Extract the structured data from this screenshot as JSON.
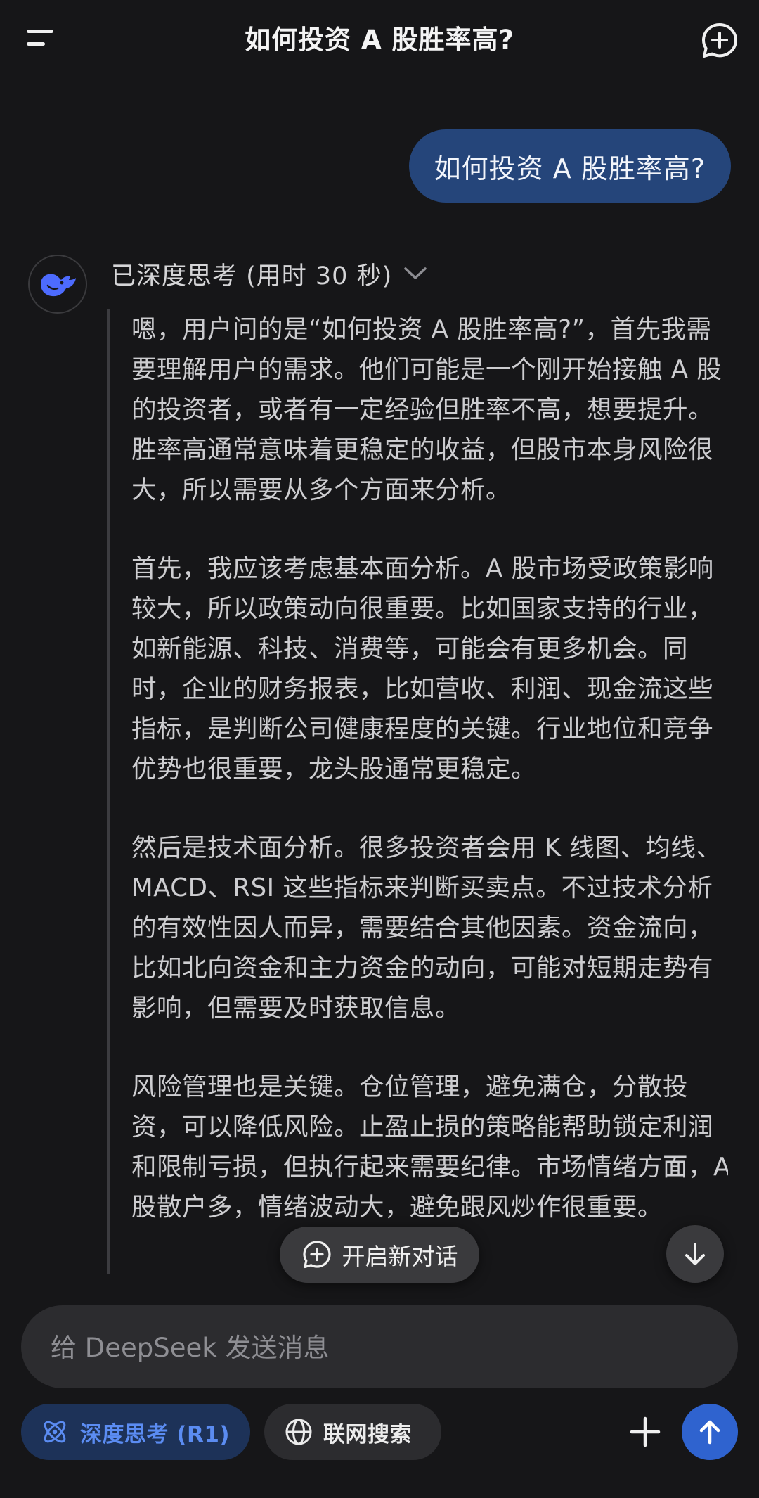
{
  "header": {
    "title": "如何投资 A 股胜率高?"
  },
  "chat": {
    "user_message": "如何投资 A 股胜率高?",
    "assistant": {
      "thinking_label": "已深度思考 (用时 30 秒)",
      "reasoning": [
        "嗯，用户问的是“如何投资 A 股胜率高?”，首先我需要理解用户的需求。他们可能是一个刚开始接触 A 股的投资者，或者有一定经验但胜率不高，想要提升。胜率高通常意味着更稳定的收益，但股市本身风险很大，所以需要从多个方面来分析。",
        "首先，我应该考虑基本面分析。A 股市场受政策影响较大，所以政策动向很重要。比如国家支持的行业，如新能源、科技、消费等，可能会有更多机会。同时，企业的财务报表，比如营收、利润、现金流这些指标，是判断公司健康程度的关键。行业地位和竞争优势也很重要，龙头股通常更稳定。",
        "然后是技术面分析。很多投资者会用 K 线图、均线、MACD、RSI 这些指标来判断买卖点。不过技术分析的有效性因人而异，需要结合其他因素。资金流向，比如北向资金和主力资金的动向，可能对短期走势有影响，但需要及时获取信息。",
        "风险管理也是关键。仓位管理，避免满仓，分散投资，可以降低风险。止盈止损的策略能帮助锁定利润和限制亏损，但执行起来需要纪律。市场情绪方面，A 股散户多，情绪波动大，避免跟风炒作很重要。"
      ]
    }
  },
  "float": {
    "new_chat_label": "开启新对话"
  },
  "composer": {
    "placeholder": "给 DeepSeek 发送消息",
    "deep_think_label": "深度思考 (R1)",
    "web_search_label": "联网搜索"
  },
  "colors": {
    "background": "#161618",
    "user_bubble": "#25457a",
    "accent": "#2f63cf",
    "deep_think_text": "#5b8cf2"
  }
}
